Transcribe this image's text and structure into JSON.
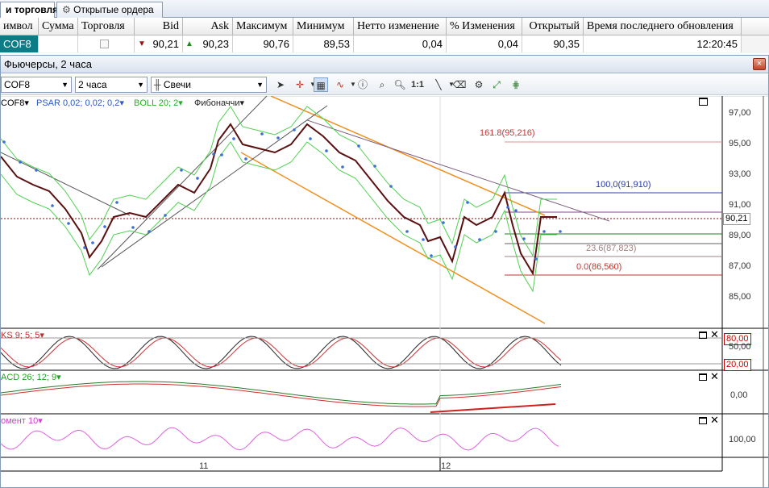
{
  "tabs": [
    {
      "label": "и торговля",
      "active": true
    },
    {
      "label": "Открытые ордера",
      "active": false
    }
  ],
  "quote_table": {
    "headers": [
      "имвол",
      "Сумма",
      "Торговля",
      "Bid",
      "Ask",
      "Максимум",
      "Минимум",
      "Нетто изменение",
      "% Изменения",
      "Открытый",
      "Время последнего обновления"
    ],
    "row": {
      "symbol": "COF8",
      "amount": "",
      "bid": "90,21",
      "ask": "90,23",
      "high": "90,76",
      "low": "89,53",
      "net_change": "0,04",
      "pct_change": "0,04",
      "open": "90,35",
      "updated": "12:20:45"
    },
    "colors": {
      "bid_arrow": "#a01010",
      "ask_arrow": "#1a8a1a",
      "symbol_bg": "#0e7c86"
    }
  },
  "window": {
    "title": "Фьючерсы, 2 часа",
    "close_glyph": "×"
  },
  "toolbar": {
    "symbol": "COF8",
    "interval": "2 часа",
    "chart_type": "Свечи",
    "onetoone": "1:1"
  },
  "chart": {
    "indicator_labels": {
      "symbol": "COF8",
      "psar": "PSAR 0,02; 0,02; 0,2",
      "boll": "BOLL 20; 2",
      "fib": "Фибоначчи"
    },
    "price_ticks": [
      "97,00",
      "95,00",
      "93,00",
      "91,00",
      "89,00",
      "87,00",
      "85,00"
    ],
    "current_price": "90,21",
    "fib_levels": [
      {
        "label": "161.8(95,216)",
        "color": "#c83232"
      },
      {
        "label": "100,0(91,910)",
        "color": "#2838a8"
      },
      {
        "label": "23.6(87,823)",
        "color": "#a08080"
      },
      {
        "label": "0.0(86,560)",
        "color": "#c83232"
      }
    ],
    "stoch": {
      "label": "KS 9; 5; 5",
      "upper": "80,00",
      "mid": "50,00",
      "lower": "20,00"
    },
    "macd": {
      "label": "ACD 26; 12; 9",
      "zero": "0,00"
    },
    "momentum": {
      "label": "омент 10",
      "level": "100,00"
    },
    "x_ticks": [
      "11",
      "12"
    ]
  }
}
